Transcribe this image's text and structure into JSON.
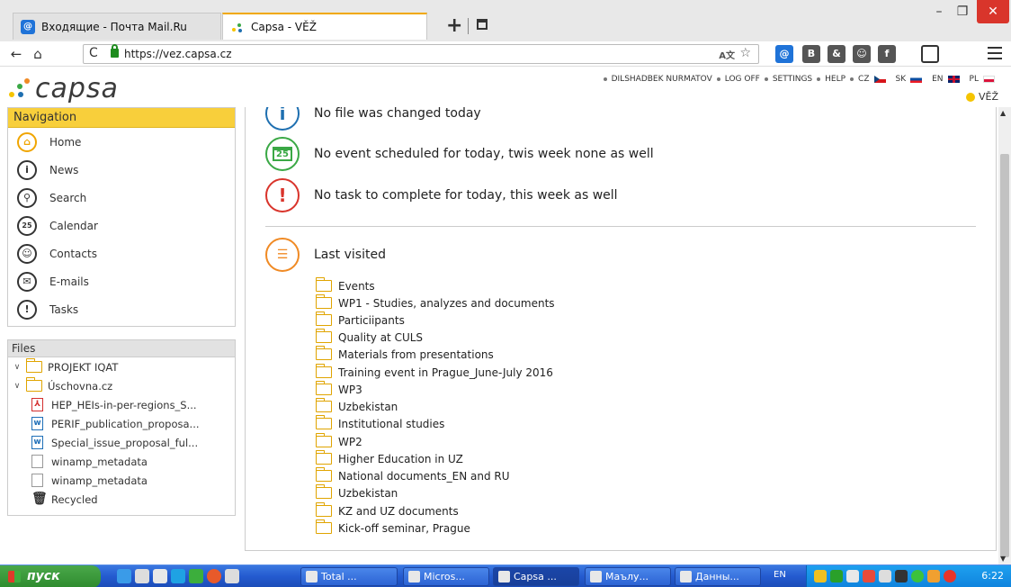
{
  "browser": {
    "tabs": [
      {
        "title": "Входящие - Почта Mail.Ru",
        "favicon": "mail-icon"
      },
      {
        "title": "Capsa - VĚŽ",
        "favicon": "capsa-icon"
      }
    ],
    "new_tab": "+",
    "url": "https://vez.capsa.cz",
    "window_controls": {
      "minimize": "–",
      "maximize": "❐",
      "close": "✕"
    }
  },
  "header": {
    "logo_text": "capsa",
    "user": "DILSHADBEK NURMATOV",
    "logoff": "LOG OFF",
    "settings": "SETTINGS",
    "help": "HELP",
    "languages": [
      "CZ",
      "SK",
      "EN",
      "PL"
    ],
    "workspace": "VĚŽ"
  },
  "navigation": {
    "title": "Navigation",
    "items": [
      {
        "label": "Home",
        "icon": "⌂"
      },
      {
        "label": "News",
        "icon": "i"
      },
      {
        "label": "Search",
        "icon": "⚲"
      },
      {
        "label": "Calendar",
        "icon": "25"
      },
      {
        "label": "Contacts",
        "icon": "☺"
      },
      {
        "label": "E-mails",
        "icon": "✉"
      },
      {
        "label": "Tasks",
        "icon": "!"
      }
    ]
  },
  "files": {
    "title": "Files",
    "items": [
      {
        "label": "PROJEKT IQAT"
      },
      {
        "label": "Úschovna.cz"
      },
      {
        "label": "HEP_HEIs-in-per-regions_S..."
      },
      {
        "label": "PERIF_publication_proposa..."
      },
      {
        "label": "Special_issue_proposal_ful..."
      },
      {
        "label": "winamp_metadata"
      },
      {
        "label": "winamp_metadata"
      },
      {
        "label": "Recycled"
      }
    ]
  },
  "main": {
    "no_file": "No file was changed today",
    "no_event": "No event scheduled for today, twis week none as well",
    "no_task": "No task to complete for today, this week as well",
    "last_visited_title": "Last visited",
    "last_visited": [
      "Events",
      "WP1 - Studies, analyzes and documents",
      "Particiipants",
      "Quality at CULS",
      "Materials from presentations",
      "Training event in Prague_June-July 2016",
      "WP3",
      "Uzbekistan",
      "Institutional studies",
      "WP2",
      "Higher Education in UZ",
      "National documents_EN and RU",
      "Uzbekistan",
      "KZ and UZ documents",
      "Kick-off seminar, Prague"
    ]
  },
  "taskbar": {
    "start": "пуск",
    "buttons": [
      "Total ...",
      "Micros...",
      "Capsa ...",
      "Маълу...",
      "Данны..."
    ],
    "language": "EN",
    "clock": "6:22"
  },
  "colors": {
    "accent": "#f8cf3b",
    "info": "#1e6fb0",
    "calendar": "#3aa845",
    "task": "#d9342b",
    "list": "#f08a24"
  }
}
